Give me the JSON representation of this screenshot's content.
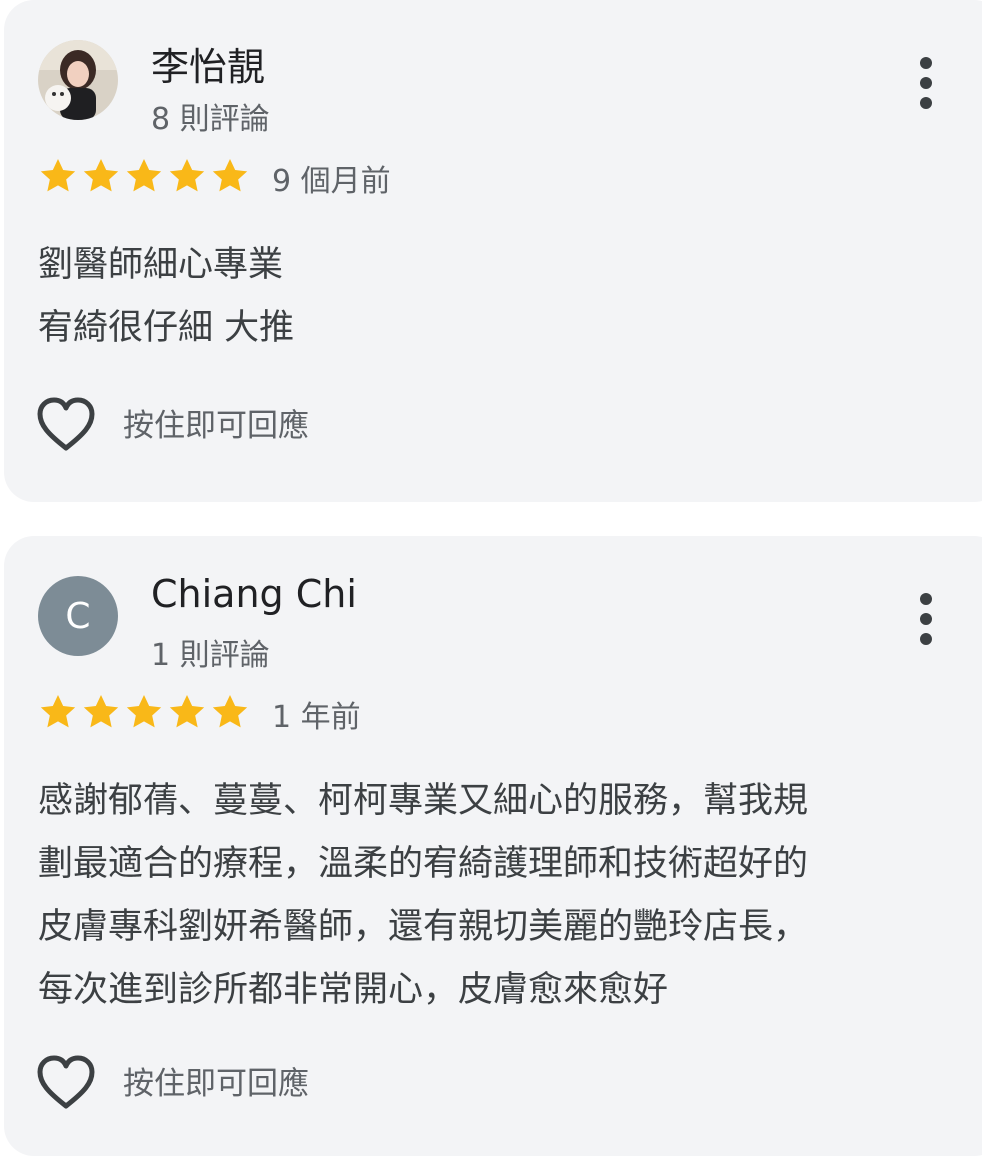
{
  "reviews": [
    {
      "author": "李怡靚",
      "review_count": "8 則評論",
      "avatar": {
        "type": "photo",
        "icon": "user-photo"
      },
      "stars": 5,
      "time": "9 個月前",
      "text": "劉醫師細心專業\n宥綺很仔細 大推",
      "like_icon": "heart-outline-icon",
      "reply_hint": "按住即可回應"
    },
    {
      "author": "Chiang Chi",
      "review_count": "1 則評論",
      "avatar": {
        "type": "letter",
        "letter": "C",
        "color": "#7d8c96"
      },
      "stars": 5,
      "time": "1 年前",
      "text": "感謝郁蒨、蔓蔓、柯柯專業又細心的服務，幫我規\n劃最適合的療程，溫柔的宥綺護理師和技術超好的\n皮膚專科劉妍希醫師，還有親切美麗的艷玲店長，\n每次進到診所都非常開心，皮膚愈來愈好",
      "like_icon": "heart-outline-icon",
      "reply_hint": "按住即可回應"
    }
  ],
  "colors": {
    "star": "#f9b818",
    "card_bg": "#f3f4f6",
    "text_primary": "#202124",
    "text_secondary": "#5f6368"
  }
}
